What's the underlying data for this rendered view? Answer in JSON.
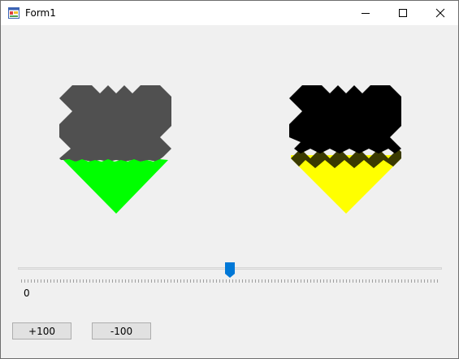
{
  "window": {
    "title": "Form1",
    "icons": {
      "app": "app-icon",
      "minimize": "minimize-icon",
      "maximize": "maximize-icon",
      "close": "close-icon"
    }
  },
  "colors": {
    "titlebar": "#FFFFFF",
    "client_background": "#F0F0F0",
    "left_shape_top": "#505050",
    "left_shape_fill": "#00FF00",
    "right_shape_top": "#000000",
    "right_shape_fill": "#FFFF00",
    "slider_thumb": "#0078D7"
  },
  "trackbar": {
    "value_label": "0",
    "thumb_position_fraction": 0.5
  },
  "buttons": {
    "increase_label": "+100",
    "decrease_label": "-100"
  }
}
